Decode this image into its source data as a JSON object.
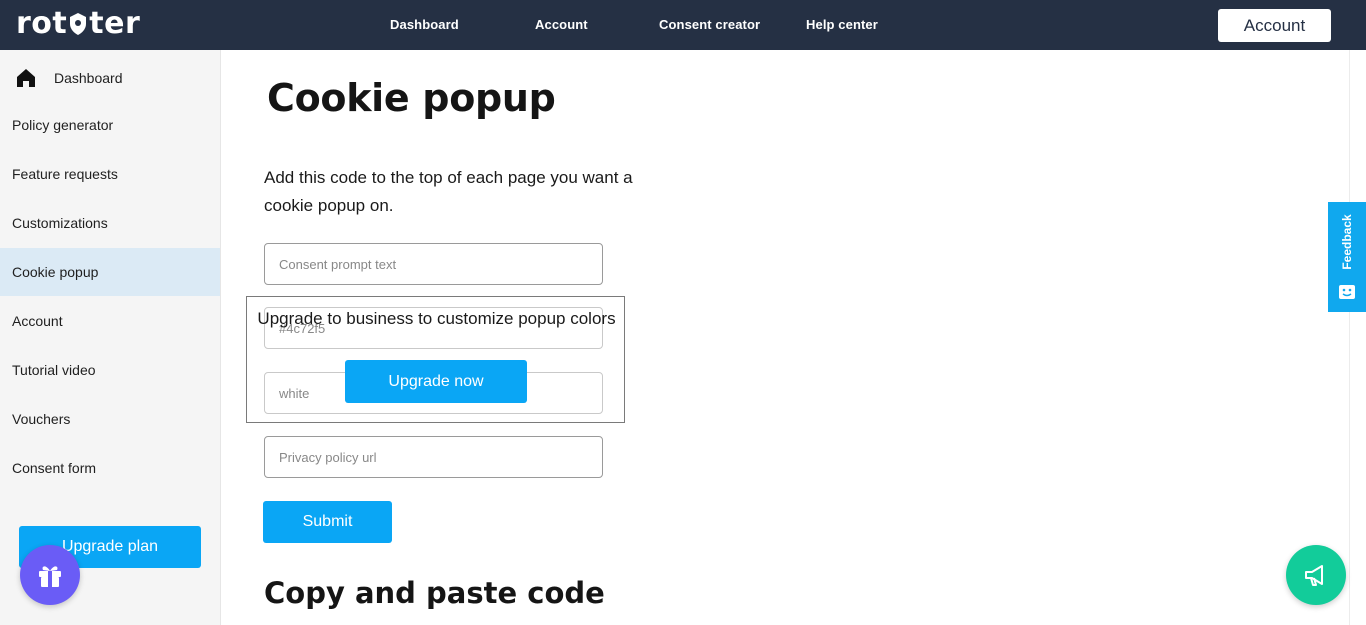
{
  "header": {
    "logo_text_left": "rot",
    "logo_text_right": "ter",
    "nav": [
      "Dashboard",
      "Account",
      "Consent creator",
      "Help center"
    ],
    "account_button": "Account"
  },
  "sidebar": {
    "items": [
      {
        "label": "Dashboard",
        "icon": "home-icon"
      },
      {
        "label": "Policy generator"
      },
      {
        "label": "Feature requests"
      },
      {
        "label": "Customizations"
      },
      {
        "label": "Cookie popup",
        "active": true
      },
      {
        "label": "Account"
      },
      {
        "label": "Tutorial video"
      },
      {
        "label": "Vouchers"
      },
      {
        "label": "Consent form"
      }
    ],
    "upgrade_button": "Upgrade plan",
    "gift_icon": "gift-icon"
  },
  "main": {
    "title": "Cookie popup",
    "intro": "Add this code to the top of each page you want a cookie popup on.",
    "fields": {
      "consent_prompt_placeholder": "Consent prompt text",
      "color_1_placeholder": "#4c72f5",
      "color_2_placeholder": "white",
      "privacy_url_placeholder": "Privacy policy url"
    },
    "upgrade_overlay": {
      "text": "Upgrade to business to customize popup colors",
      "button": "Upgrade now"
    },
    "submit_button": "Submit",
    "section_title": "Copy and paste code"
  },
  "feedback_tab": {
    "label": "Feedback"
  },
  "colors": {
    "topbar": "#253044",
    "accent": "#0aa6f5",
    "gift_bg": "#6a5cf6",
    "announce_bg": "#12cc9a",
    "active_item_bg": "#dbeaf5"
  }
}
